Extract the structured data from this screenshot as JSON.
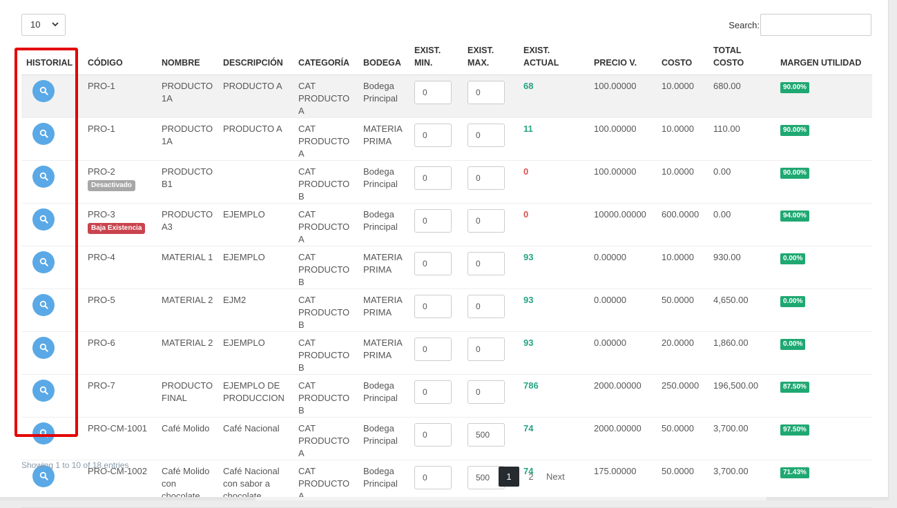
{
  "length_select": {
    "value": "10"
  },
  "search": {
    "label": "Search:",
    "placeholder": ""
  },
  "columns": [
    "HISTORIAL",
    "CÓDIGO",
    "NOMBRE",
    "DESCRIPCIÓN",
    "CATEGORÍA",
    "BODEGA",
    "EXIST. MIN.",
    "EXIST. MAX.",
    "EXIST. ACTUAL",
    "PRECIO V.",
    "COSTO",
    "TOTAL COSTO",
    "MARGEN UTILIDAD"
  ],
  "rows": [
    {
      "codigo": "PRO-1",
      "badge": "",
      "nombre": "PRODUCTO 1A",
      "descripcion": "PRODUCTO A",
      "categoria": "CAT PRODUCTO A",
      "bodega": "Bodega Principal",
      "min": "0",
      "max": "0",
      "actual": "68",
      "precio": "100.00000",
      "costo": "10.0000",
      "total": "680.00",
      "margen": "90.00%"
    },
    {
      "codigo": "PRO-1",
      "badge": "",
      "nombre": "PRODUCTO 1A",
      "descripcion": "PRODUCTO A",
      "categoria": "CAT PRODUCTO A",
      "bodega": "MATERIA PRIMA",
      "min": "0",
      "max": "0",
      "actual": "11",
      "precio": "100.00000",
      "costo": "10.0000",
      "total": "110.00",
      "margen": "90.00%"
    },
    {
      "codigo": "PRO-2",
      "badge": "Desactivado",
      "nombre": "PRODUCTO B1",
      "descripcion": "",
      "categoria": "CAT PRODUCTO B",
      "bodega": "Bodega Principal",
      "min": "0",
      "max": "0",
      "actual": "0",
      "precio": "100.00000",
      "costo": "10.0000",
      "total": "0.00",
      "margen": "90.00%"
    },
    {
      "codigo": "PRO-3",
      "badge": "Baja Existencia",
      "nombre": "PRODUCTO A3",
      "descripcion": "EJEMPLO",
      "categoria": "CAT PRODUCTO A",
      "bodega": "Bodega Principal",
      "min": "0",
      "max": "0",
      "actual": "0",
      "precio": "10000.00000",
      "costo": "600.0000",
      "total": "0.00",
      "margen": "94.00%"
    },
    {
      "codigo": "PRO-4",
      "badge": "",
      "nombre": "MATERIAL 1",
      "descripcion": "EJEMPLO",
      "categoria": "CAT PRODUCTO B",
      "bodega": "MATERIA PRIMA",
      "min": "0",
      "max": "0",
      "actual": "93",
      "precio": "0.00000",
      "costo": "10.0000",
      "total": "930.00",
      "margen": "0.00%"
    },
    {
      "codigo": "PRO-5",
      "badge": "",
      "nombre": "MATERIAL 2",
      "descripcion": "EJM2",
      "categoria": "CAT PRODUCTO B",
      "bodega": "MATERIA PRIMA",
      "min": "0",
      "max": "0",
      "actual": "93",
      "precio": "0.00000",
      "costo": "50.0000",
      "total": "4,650.00",
      "margen": "0.00%"
    },
    {
      "codigo": "PRO-6",
      "badge": "",
      "nombre": "MATERIAL 2",
      "descripcion": "EJEMPLO",
      "categoria": "CAT PRODUCTO B",
      "bodega": "MATERIA PRIMA",
      "min": "0",
      "max": "0",
      "actual": "93",
      "precio": "0.00000",
      "costo": "20.0000",
      "total": "1,860.00",
      "margen": "0.00%"
    },
    {
      "codigo": "PRO-7",
      "badge": "",
      "nombre": "PRODUCTO FINAL",
      "descripcion": "EJEMPLO DE PRODUCCION",
      "categoria": "CAT PRODUCTO B",
      "bodega": "Bodega Principal",
      "min": "0",
      "max": "0",
      "actual": "786",
      "precio": "2000.00000",
      "costo": "250.0000",
      "total": "196,500.00",
      "margen": "87.50%"
    },
    {
      "codigo": "PRO-CM-1001",
      "badge": "",
      "nombre": "Café Molido",
      "descripcion": "Café Nacional",
      "categoria": "CAT PRODUCTO A",
      "bodega": "Bodega Principal",
      "min": "0",
      "max": "500",
      "actual": "74",
      "precio": "2000.00000",
      "costo": "50.0000",
      "total": "3,700.00",
      "margen": "97.50%"
    },
    {
      "codigo": "PRO-CM-1002",
      "badge": "",
      "nombre": "Café Molido con chocolate",
      "descripcion": "Café Nacional con sabor a chocolate",
      "categoria": "CAT PRODUCTO A",
      "bodega": "Bodega Principal",
      "min": "0",
      "max": "500",
      "actual": "74",
      "precio": "175.00000",
      "costo": "50.0000",
      "total": "3,700.00",
      "margen": "71.43%"
    }
  ],
  "info": "Showing 1 to 10 of 18 entries",
  "pagination": {
    "pages": [
      "1",
      "2"
    ],
    "active": "1",
    "next": "Next"
  },
  "colors": {
    "accent_blue": "#5aa9e6",
    "success": "#1fa872",
    "stock_green": "#26a384",
    "stock_red": "#d9534f",
    "badge_gray": "#a7a7a7",
    "badge_red": "#c9434d",
    "highlight_red": "#e30000",
    "pager_active": "#262b30"
  },
  "icons": {
    "history_button": "search-icon",
    "select_arrow": "chevron-down-icon"
  }
}
